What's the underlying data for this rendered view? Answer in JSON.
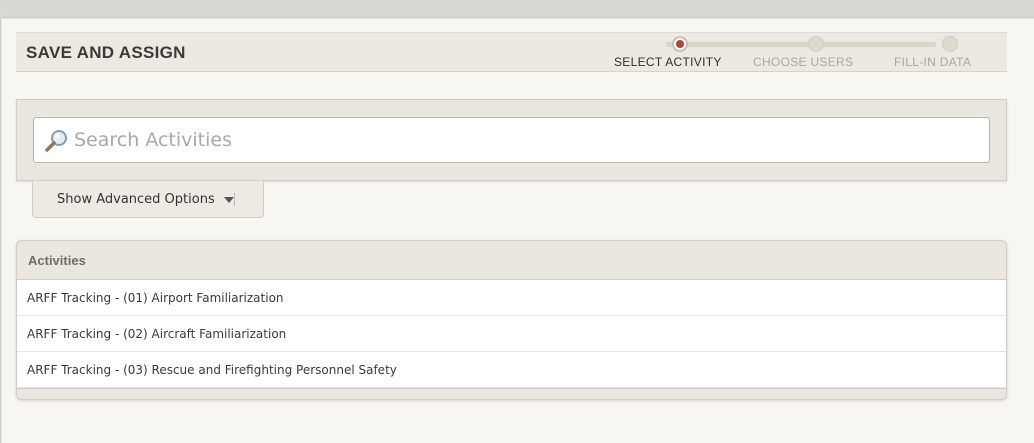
{
  "header": {
    "title": "SAVE AND ASSIGN",
    "steps": [
      {
        "label": "SELECT ACTIVITY",
        "active": true
      },
      {
        "label": "CHOOSE USERS",
        "active": false
      },
      {
        "label": "FILL-IN DATA",
        "active": false
      }
    ]
  },
  "search": {
    "placeholder": "Search Activities",
    "value": ""
  },
  "advanced": {
    "label": "Show Advanced Options"
  },
  "activities": {
    "title": "Activities",
    "items": [
      "ARFF Tracking - (01) Airport Familiarization",
      "ARFF Tracking - (02) Aircraft Familiarization",
      "ARFF Tracking - (03) Rescue and Firefighting Personnel Safety"
    ]
  },
  "colors": {
    "active_step": "#c43a3a",
    "panel_bg": "#f7f6f1",
    "header_bg": "#ebe9e2"
  },
  "icons": {
    "search": "search-icon",
    "dropdown": "caret-down-icon"
  }
}
